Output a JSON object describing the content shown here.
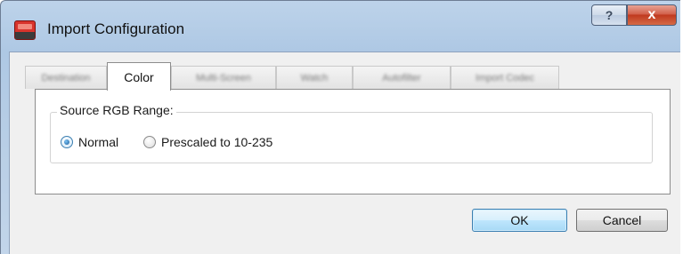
{
  "window": {
    "title": "Import Configuration",
    "help_label": "?",
    "close_label": "x"
  },
  "tabs": [
    {
      "label": "Destination",
      "active": false
    },
    {
      "label": "Color",
      "active": true
    },
    {
      "label": "Multi-Screen",
      "active": false
    },
    {
      "label": "Watch",
      "active": false
    },
    {
      "label": "Autofilter",
      "active": false
    },
    {
      "label": "Import Codec",
      "active": false
    }
  ],
  "color_tab": {
    "group_label": "Source RGB Range:",
    "options": [
      {
        "label": "Normal",
        "selected": true
      },
      {
        "label": "Prescaled to 10-235",
        "selected": false
      }
    ]
  },
  "buttons": {
    "ok": "OK",
    "cancel": "Cancel"
  },
  "colors": {
    "title_bar": "#b9cfe6",
    "close_button": "#c0391f",
    "ok_border": "#3c7fb1"
  }
}
